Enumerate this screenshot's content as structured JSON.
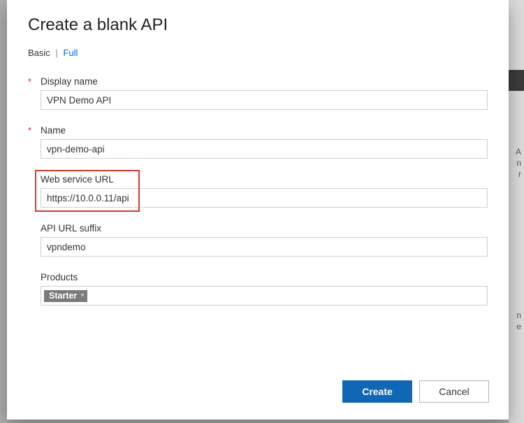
{
  "dialog": {
    "title": "Create a blank API",
    "tabs": {
      "basic": "Basic",
      "full": "Full"
    },
    "fields": {
      "display_name": {
        "label": "Display name",
        "value": "VPN Demo API",
        "required": true
      },
      "name": {
        "label": "Name",
        "value": "vpn-demo-api",
        "required": true
      },
      "web_url": {
        "label": "Web service URL",
        "value": "https://10.0.0.11/api",
        "required": false
      },
      "suffix": {
        "label": "API URL suffix",
        "value": "vpndemo",
        "required": false
      },
      "products": {
        "label": "Products",
        "tags": [
          "Starter"
        ]
      }
    },
    "buttons": {
      "create": "Create",
      "cancel": "Cancel"
    }
  }
}
